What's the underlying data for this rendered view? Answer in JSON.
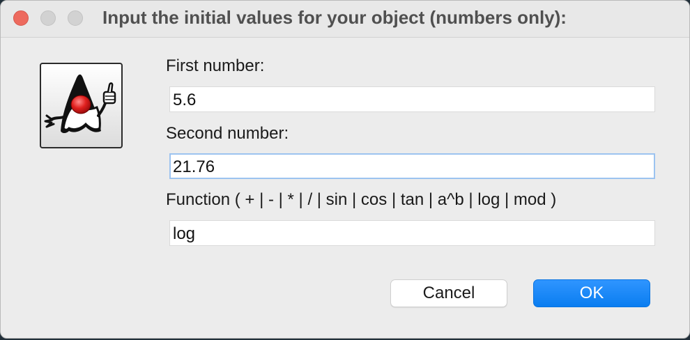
{
  "dialog": {
    "title": "Input the initial values for your object (numbers only):",
    "icon_name": "java-duke-icon"
  },
  "fields": [
    {
      "label": "First number:",
      "value": "5.6"
    },
    {
      "label": "Second number:",
      "value": "21.76"
    },
    {
      "label": "Function ( + | - | * | / | sin | cos | tan | a^b | log | mod )",
      "value": "log"
    }
  ],
  "buttons": {
    "cancel": "Cancel",
    "ok": "OK"
  },
  "colors": {
    "close": "#ed6a5e",
    "accent": "#0a7df0",
    "focus_ring": "#9cc3f0"
  }
}
